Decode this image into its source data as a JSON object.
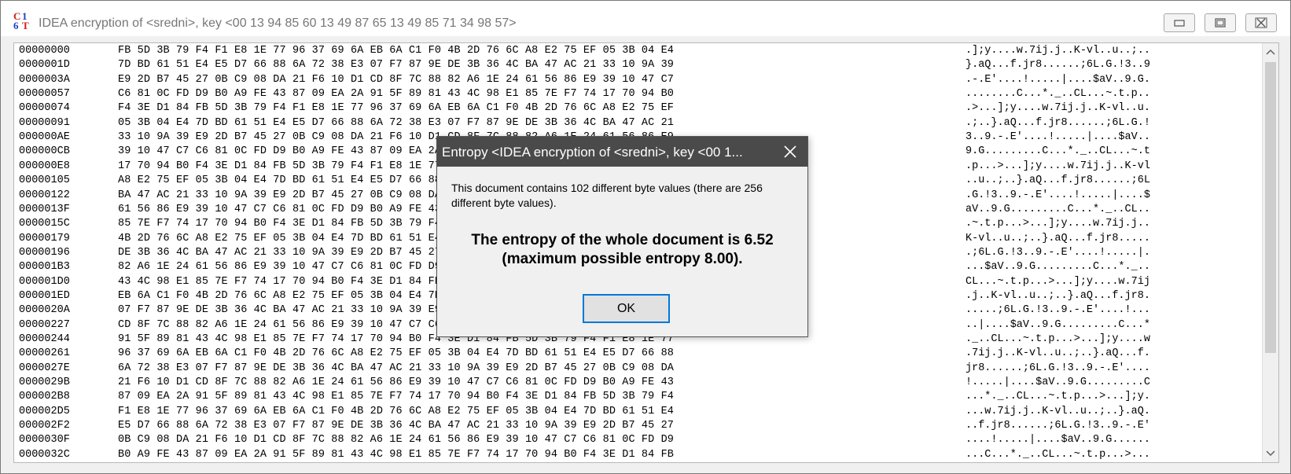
{
  "window": {
    "title": "IDEA encryption of <sredni>, key <00 13 94 85 60 13 49 87 65 13 49 85 71 34 98 57>",
    "icon": "cryptool-logo-icon"
  },
  "hex_rows": [
    {
      "addr": "00000000",
      "bytes": "FB 5D 3B 79 F4 F1 E8 1E 77 96 37 69 6A EB 6A C1 F0 4B 2D 76 6C A8 E2 75 EF 05 3B 04 E4",
      "ascii": ".];y....w.7ij.j..K-vl..u..;.."
    },
    {
      "addr": "0000001D",
      "bytes": "7D BD 61 51 E4 E5 D7 66 88 6A 72 38 E3 07 F7 87 9E DE 3B 36 4C BA 47 AC 21 33 10 9A 39",
      "ascii": "}.aQ...f.jr8......;6L.G.!3..9"
    },
    {
      "addr": "0000003A",
      "bytes": "E9 2D B7 45 27 0B C9 08 DA 21 F6 10 D1 CD 8F 7C 88 82 A6 1E 24 61 56 86 E9 39 10 47 C7",
      "ascii": ".-.E'....!.....|....$aV..9.G."
    },
    {
      "addr": "00000057",
      "bytes": "C6 81 0C FD D9 B0 A9 FE 43 87 09 EA 2A 91 5F 89 81 43 4C 98 E1 85 7E F7 74 17 70 94 B0",
      "ascii": "........C...*._..CL...~.t.p.."
    },
    {
      "addr": "00000074",
      "bytes": "F4 3E D1 84 FB 5D 3B 79 F4 F1 E8 1E 77 96 37 69 6A EB 6A C1 F0 4B 2D 76 6C A8 E2 75 EF",
      "ascii": ".>...];y....w.7ij.j..K-vl..u."
    },
    {
      "addr": "00000091",
      "bytes": "05 3B 04 E4 7D BD 61 51 E4 E5 D7 66 88 6A 72 38 E3 07 F7 87 9E DE 3B 36 4C BA 47 AC 21",
      "ascii": ".;..}.aQ...f.jr8......;6L.G.!"
    },
    {
      "addr": "000000AE",
      "bytes": "33 10 9A 39 E9 2D B7 45 27 0B C9 08 DA 21 F6 10 D1 CD 8F 7C 88 82 A6 1E 24 61 56 86 E9",
      "ascii": "3..9.-.E'....!.....|....$aV.."
    },
    {
      "addr": "000000CB",
      "bytes": "39 10 47 C7 C6 81 0C FD D9 B0 A9 FE 43 87 09 EA 2A 91 5F 89 81 43 4C 98 E1 85 7E F7 74",
      "ascii": "9.G.........C...*._..CL...~.t"
    },
    {
      "addr": "000000E8",
      "bytes": "17 70 94 B0 F4 3E D1 84 FB 5D 3B 79 F4 F1 E8 1E 77 96 37 69 6A EB 6A C1 F0 4B 2D 76 6C",
      "ascii": ".p...>...];y....w.7ij.j..K-vl"
    },
    {
      "addr": "00000105",
      "bytes": "A8 E2 75 EF 05 3B 04 E4 7D BD 61 51 E4 E5 D7 66 88 6A 72 38 E3 07 F7 87 9E DE 3B 36 4C",
      "ascii": "..u..;..}.aQ...f.jr8......;6L"
    },
    {
      "addr": "00000122",
      "bytes": "BA 47 AC 21 33 10 9A 39 E9 2D B7 45 27 0B C9 08 DA 21 F6 10 D1 CD 8F 7C 88 82 A6 1E 24",
      "ascii": ".G.!3..9.-.E'....!.....|....$"
    },
    {
      "addr": "0000013F",
      "bytes": "61 56 86 E9 39 10 47 C7 C6 81 0C FD D9 B0 A9 FE 43 87 09 EA 2A 91 5F 89 81 43 4C 98 E1",
      "ascii": "aV..9.G.........C...*._..CL.."
    },
    {
      "addr": "0000015C",
      "bytes": "85 7E F7 74 17 70 94 B0 F4 3E D1 84 FB 5D 3B 79 F4 F1 E8 1E 77 96 37 69 6A EB 6A C1 F0",
      "ascii": ".~.t.p...>...];y....w.7ij.j.."
    },
    {
      "addr": "00000179",
      "bytes": "4B 2D 76 6C A8 E2 75 EF 05 3B 04 E4 7D BD 61 51 E4 E5 D7 66 88 6A 72 38 E3 07 F7 87 9E",
      "ascii": "K-vl..u..;..}.aQ...f.jr8....."
    },
    {
      "addr": "00000196",
      "bytes": "DE 3B 36 4C BA 47 AC 21 33 10 9A 39 E9 2D B7 45 27 0B C9 08 DA 21 F6 10 D1 CD 8F 7C 88",
      "ascii": ".;6L.G.!3..9.-.E'....!.....|."
    },
    {
      "addr": "000001B3",
      "bytes": "82 A6 1E 24 61 56 86 E9 39 10 47 C7 C6 81 0C FD D9 B0 A9 FE 43 87 09 EA 2A 91 5F 89 81",
      "ascii": "...$aV..9.G.........C...*._.."
    },
    {
      "addr": "000001D0",
      "bytes": "43 4C 98 E1 85 7E F7 74 17 70 94 B0 F4 3E D1 84 FB 5D 3B 79 F4 F1 E8 1E 77 96 37 69 6A",
      "ascii": "CL...~.t.p...>...];y....w.7ij"
    },
    {
      "addr": "000001ED",
      "bytes": "EB 6A C1 F0 4B 2D 76 6C A8 E2 75 EF 05 3B 04 E4 7D BD 61 51 E4 E5 D7 66 88 6A 72 38 E3",
      "ascii": ".j..K-vl..u..;..}.aQ...f.jr8."
    },
    {
      "addr": "0000020A",
      "bytes": "07 F7 87 9E DE 3B 36 4C BA 47 AC 21 33 10 9A 39 E9 2D B7 45 27 0B C9 08 DA 21 F6 10 D1",
      "ascii": ".....;6L.G.!3..9.-.E'....!..."
    },
    {
      "addr": "00000227",
      "bytes": "CD 8F 7C 88 82 A6 1E 24 61 56 86 E9 39 10 47 C7 C6 81 0C FD D9 B0 A9 FE 43 87 09 EA 2A",
      "ascii": "..|....$aV..9.G.........C...*"
    },
    {
      "addr": "00000244",
      "bytes": "91 5F 89 81 43 4C 98 E1 85 7E F7 74 17 70 94 B0 F4 3E D1 84 FB 5D 3B 79 F4 F1 E8 1E 77",
      "ascii": "._..CL...~.t.p...>...];y....w"
    },
    {
      "addr": "00000261",
      "bytes": "96 37 69 6A EB 6A C1 F0 4B 2D 76 6C A8 E2 75 EF 05 3B 04 E4 7D BD 61 51 E4 E5 D7 66 88",
      "ascii": ".7ij.j..K-vl..u..;..}.aQ...f."
    },
    {
      "addr": "0000027E",
      "bytes": "6A 72 38 E3 07 F7 87 9E DE 3B 36 4C BA 47 AC 21 33 10 9A 39 E9 2D B7 45 27 0B C9 08 DA",
      "ascii": "jr8......;6L.G.!3..9.-.E'...."
    },
    {
      "addr": "0000029B",
      "bytes": "21 F6 10 D1 CD 8F 7C 88 82 A6 1E 24 61 56 86 E9 39 10 47 C7 C6 81 0C FD D9 B0 A9 FE 43",
      "ascii": "!.....|....$aV..9.G.........C"
    },
    {
      "addr": "000002B8",
      "bytes": "87 09 EA 2A 91 5F 89 81 43 4C 98 E1 85 7E F7 74 17 70 94 B0 F4 3E D1 84 FB 5D 3B 79 F4",
      "ascii": "...*._..CL...~.t.p...>...];y."
    },
    {
      "addr": "000002D5",
      "bytes": "F1 E8 1E 77 96 37 69 6A EB 6A C1 F0 4B 2D 76 6C A8 E2 75 EF 05 3B 04 E4 7D BD 61 51 E4",
      "ascii": "...w.7ij.j..K-vl..u..;..}.aQ."
    },
    {
      "addr": "000002F2",
      "bytes": "E5 D7 66 88 6A 72 38 E3 07 F7 87 9E DE 3B 36 4C BA 47 AC 21 33 10 9A 39 E9 2D B7 45 27",
      "ascii": "..f.jr8......;6L.G.!3..9.-.E'"
    },
    {
      "addr": "0000030F",
      "bytes": "0B C9 08 DA 21 F6 10 D1 CD 8F 7C 88 82 A6 1E 24 61 56 86 E9 39 10 47 C7 C6 81 0C FD D9",
      "ascii": "....!.....|....$aV..9.G......"
    },
    {
      "addr": "0000032C",
      "bytes": "B0 A9 FE 43 87 09 EA 2A 91 5F 89 81 43 4C 98 E1 85 7E F7 74 17 70 94 B0 F4 3E D1 84 FB",
      "ascii": "...C...*._..CL...~.t.p...>..."
    }
  ],
  "dialog": {
    "title": "Entropy <IDEA encryption of <sredni>, key <00 1...",
    "info_text": "This document contains 102 different byte values (there are 256 different byte values).",
    "entropy_line1": "The entropy of the whole document is 6.52",
    "entropy_line2": "(maximum possible entropy 8.00).",
    "ok_label": "OK"
  },
  "colors": {
    "dialog_titlebar": "#4a4a4a",
    "ok_focus_border": "#0078d7"
  }
}
